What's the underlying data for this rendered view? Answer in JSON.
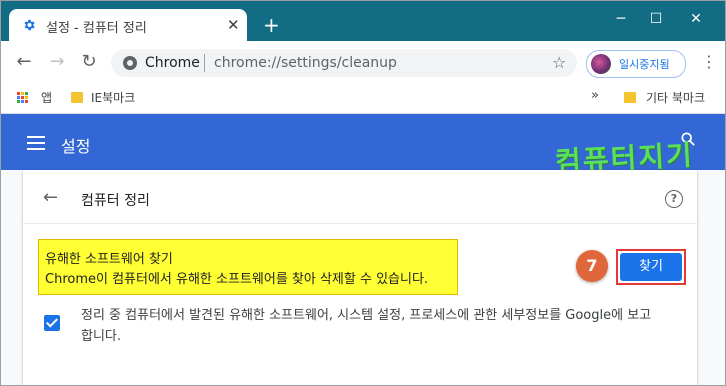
{
  "browser": {
    "tab_title": "설정 - 컴퓨터 정리",
    "tab_close": "✕",
    "new_tab": "+",
    "window_controls": {
      "minimize": "─",
      "maximize": "☐",
      "close": "✕"
    },
    "omnibox": {
      "site_label": "Chrome",
      "url": "chrome://settings/cleanup"
    },
    "profile_label": "일시중지됨",
    "nav": {
      "back": "←",
      "forward": "→",
      "reload": "↻"
    }
  },
  "bookmarks": {
    "apps_label": "앱",
    "ie_bookmarks": "IE북마크",
    "more": "»",
    "other_bookmarks": "기타 북마크"
  },
  "settings_header": {
    "title": "설정"
  },
  "watermark": "컴퓨터지기",
  "page": {
    "title": "컴퓨터 정리",
    "help": "?",
    "find_section": {
      "title": "유해한 소프트웨어 찾기",
      "description": "Chrome이 컴퓨터에서 유해한 소프트웨어를 찾아 삭제할 수 있습니다.",
      "step_number": "7",
      "find_button": "찾기"
    },
    "report_checkbox": {
      "checked": true,
      "label_line1": "정리 중 컴퓨터에서 발견된 유해한 소프트웨어, 시스템 설정, 프로세스에 관한 세부정보를 Google에 보고",
      "label_line2": "합니다."
    }
  },
  "colors": {
    "tab_strip": "#126d84",
    "settings_bar": "#3367d6",
    "highlight": "#ffff33",
    "primary_button": "#1a73e8",
    "step_badge": "#e0673c",
    "button_outline": "#e53935",
    "watermark": "#5be05b"
  }
}
